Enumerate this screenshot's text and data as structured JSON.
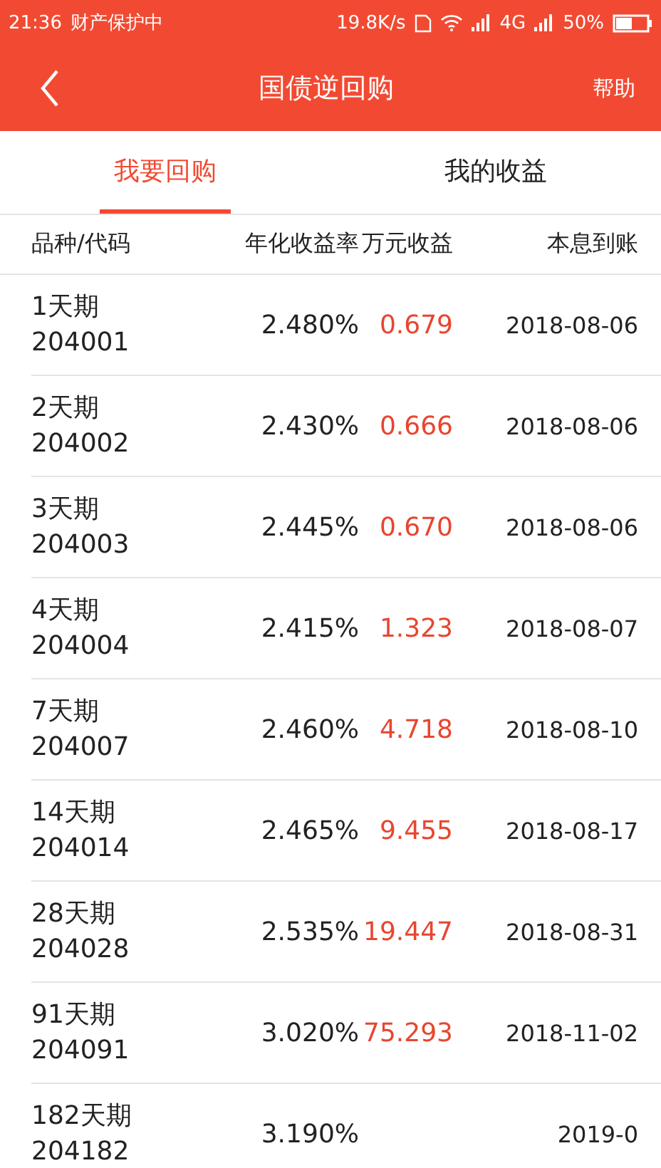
{
  "status_bar": {
    "time": "21:36",
    "notice": "财产保护中",
    "speed": "19.8K/s",
    "network": "4G",
    "battery": "50%"
  },
  "header": {
    "title": "国债逆回购",
    "action": "帮助"
  },
  "tabs": [
    {
      "label": "我要回购",
      "selected": true
    },
    {
      "label": "我的收益",
      "selected": false
    }
  ],
  "table": {
    "columns": [
      "品种/代码",
      "年化收益率",
      "万元收益",
      "本息到账"
    ],
    "rows": [
      {
        "term": "1天期",
        "code": "204001",
        "rate": "2.480%",
        "earning": "0.679",
        "date": "2018-08-06"
      },
      {
        "term": "2天期",
        "code": "204002",
        "rate": "2.430%",
        "earning": "0.666",
        "date": "2018-08-06"
      },
      {
        "term": "3天期",
        "code": "204003",
        "rate": "2.445%",
        "earning": "0.670",
        "date": "2018-08-06"
      },
      {
        "term": "4天期",
        "code": "204004",
        "rate": "2.415%",
        "earning": "1.323",
        "date": "2018-08-07"
      },
      {
        "term": "7天期",
        "code": "204007",
        "rate": "2.460%",
        "earning": "4.718",
        "date": "2018-08-10"
      },
      {
        "term": "14天期",
        "code": "204014",
        "rate": "2.465%",
        "earning": "9.455",
        "date": "2018-08-17"
      },
      {
        "term": "28天期",
        "code": "204028",
        "rate": "2.535%",
        "earning": "19.447",
        "date": "2018-08-31"
      },
      {
        "term": "91天期",
        "code": "204091",
        "rate": "3.020%",
        "earning": "75.293",
        "date": "2018-11-02"
      },
      {
        "term": "182天期",
        "code": "204182",
        "rate": "3.190%",
        "date": "2019-0"
      }
    ]
  }
}
